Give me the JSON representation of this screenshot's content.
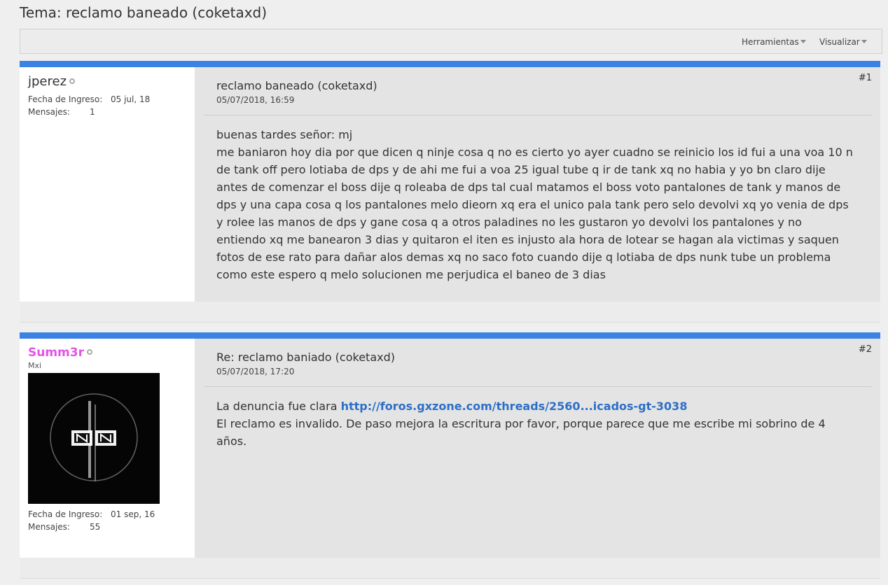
{
  "thread": {
    "title": "Tema: reclamo baneado (coketaxd)"
  },
  "toolbar": {
    "tools_label": "Herramientas",
    "view_label": "Visualizar"
  },
  "posts": [
    {
      "number": "#1",
      "user": {
        "name": "jperez",
        "join_label": "Fecha de Ingreso:",
        "join_value": "05 jul, 18",
        "posts_label": "Mensajes:",
        "posts_value": "1"
      },
      "title": "reclamo baneado (coketaxd)",
      "date": "05/07/2018, 16:59",
      "body_lines": [
        "buenas tardes señor: mj",
        "me baniaron hoy dia por que dicen q ninje cosa q no es cierto yo ayer cuadno se reinicio los id fui a una voa 10 n",
        "de tank off pero lotiaba de dps y de ahi me fui a voa 25 igual tube q ir de tank xq no habia y yo bn claro dije",
        "antes de comenzar el boss dije q roleaba de dps tal cual matamos el boss voto pantalones de tank y manos de",
        "dps y una capa cosa q los pantalones melo dieorn xq era el unico pala tank pero selo devolvi xq yo venia de dps",
        "y rolee las manos de dps y gane cosa q a otros paladines no les gustaron yo devolvi los pantalones y no",
        "entiendo xq me banearon 3 dias y quitaron el iten es injusto ala hora de lotear se hagan ala victimas y saquen",
        "fotos de ese rato para dañar alos demas xq no saco foto cuando dije q lotiaba de dps nunk tube un problema",
        "como este espero q melo solucionen me perjudica el baneo de 3 dias"
      ]
    },
    {
      "number": "#2",
      "user": {
        "name": "Summ3r",
        "title": "Mxi",
        "join_label": "Fecha de Ingreso:",
        "join_value": "01 sep, 16",
        "posts_label": "Mensajes:",
        "posts_value": "55"
      },
      "title": "Re: reclamo baniado (coketaxd)",
      "date": "05/07/2018, 17:20",
      "body_prefix": "La denuncia fue clara ",
      "link_text": "http://foros.gxzone.com/threads/2560...icados-gt-3038",
      "body_line2": "El reclamo es invalido. De paso mejora la escritura por favor, porque parece que me escribe mi sobrino de 4",
      "body_line3": "años."
    }
  ],
  "colors": {
    "accent_bar": "#3b82e4",
    "username2": "#e254e6",
    "link": "#2d6fc7"
  }
}
